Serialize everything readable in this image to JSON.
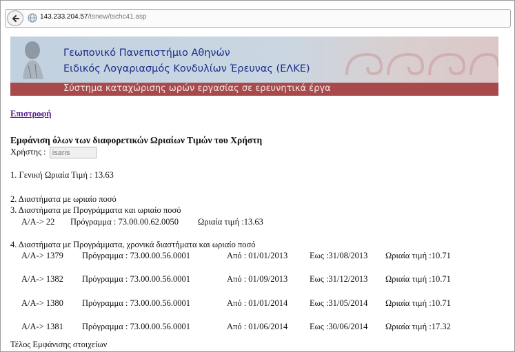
{
  "browser": {
    "url_host": "143.233.204.57",
    "url_path": "/tsnew/tschc41.asp"
  },
  "banner": {
    "line1": "Γεωπονικό Πανεπιστήμιο Αθηνών",
    "line2": "Ειδικός Λογαριασμός Κονδυλίων Έρευνας (ΕΛΚΕ)",
    "line3": "Σύστημα καταχώρισης ωρών εργασίας σε ερευνητικά έργα"
  },
  "back_link": "Επιστροφή",
  "heading": "Εμφάνιση όλων των διαφορετικών Ωριαίων Τιμών του Χρήστη",
  "user": {
    "label": "Χρήστης :",
    "value": "isaris"
  },
  "general": "1. Γενική Ωριαία Τιμή : 13.63",
  "section2": "2. Διαστήματα με ωριαίο ποσό",
  "section3": {
    "title": "3. Διαστήματα με Προγράμματα και ωριαίο ποσό",
    "rows": [
      {
        "aa": "Α/Α-> 22",
        "program": "Πρόγραμμα : 73.00.00.62.0050",
        "rate": "Ωριαία τιμή :13.63"
      }
    ]
  },
  "section4": {
    "title": "4. Διαστήματα με Προγράμματα, χρονικά διαστήματα και ωριαίο ποσό",
    "rows": [
      {
        "aa": "Α/Α-> 1379",
        "program": "Πρόγραμμα : 73.00.00.56.0001",
        "from": "Από : 01/01/2013",
        "to": "Εως :31/08/2013",
        "rate": "Ωριαία τιμή :10.71"
      },
      {
        "aa": "Α/Α-> 1382",
        "program": "Πρόγραμμα : 73.00.00.56.0001",
        "from": "Από : 01/09/2013",
        "to": "Εως :31/12/2013",
        "rate": "Ωριαία τιμή :10.71"
      },
      {
        "aa": "Α/Α-> 1380",
        "program": "Πρόγραμμα : 73.00.00.56.0001",
        "from": "Από : 01/01/2014",
        "to": "Εως :31/05/2014",
        "rate": "Ωριαία τιμή :10.71"
      },
      {
        "aa": "Α/Α-> 1381",
        "program": "Πρόγραμμα : 73.00.00.56.0001",
        "from": "Από : 01/06/2014",
        "to": "Εως :30/06/2014",
        "rate": "Ωριαία τιμή :17.32"
      }
    ]
  },
  "footer": "Τέλος Εμφάνισης στοιχείων",
  "colors": {
    "banner_text": "#1c2d8a",
    "banner_bar": "#a8494b",
    "link": "#551a8b"
  },
  "icons": [
    "back-arrow-icon",
    "globe-icon",
    "statue-logo"
  ]
}
